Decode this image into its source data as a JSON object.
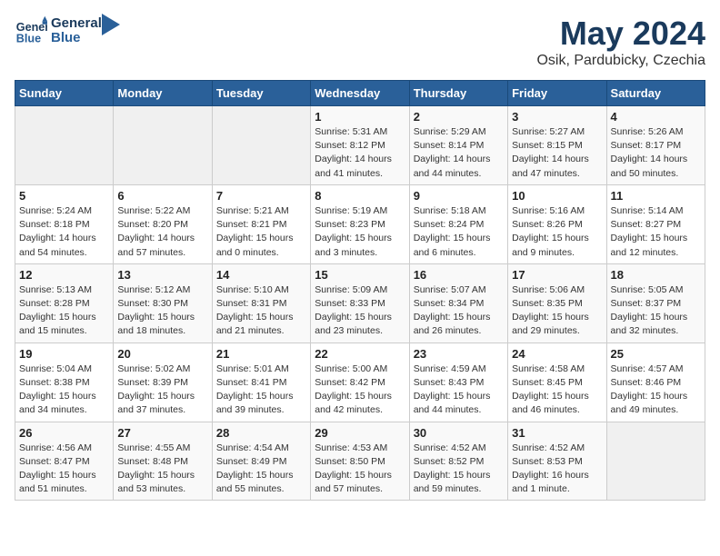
{
  "logo": {
    "line1": "General",
    "line2": "Blue"
  },
  "title": "May 2024",
  "subtitle": "Osik, Pardubicky, Czechia",
  "headers": [
    "Sunday",
    "Monday",
    "Tuesday",
    "Wednesday",
    "Thursday",
    "Friday",
    "Saturday"
  ],
  "weeks": [
    [
      {
        "day": "",
        "info": ""
      },
      {
        "day": "",
        "info": ""
      },
      {
        "day": "",
        "info": ""
      },
      {
        "day": "1",
        "info": "Sunrise: 5:31 AM\nSunset: 8:12 PM\nDaylight: 14 hours\nand 41 minutes."
      },
      {
        "day": "2",
        "info": "Sunrise: 5:29 AM\nSunset: 8:14 PM\nDaylight: 14 hours\nand 44 minutes."
      },
      {
        "day": "3",
        "info": "Sunrise: 5:27 AM\nSunset: 8:15 PM\nDaylight: 14 hours\nand 47 minutes."
      },
      {
        "day": "4",
        "info": "Sunrise: 5:26 AM\nSunset: 8:17 PM\nDaylight: 14 hours\nand 50 minutes."
      }
    ],
    [
      {
        "day": "5",
        "info": "Sunrise: 5:24 AM\nSunset: 8:18 PM\nDaylight: 14 hours\nand 54 minutes."
      },
      {
        "day": "6",
        "info": "Sunrise: 5:22 AM\nSunset: 8:20 PM\nDaylight: 14 hours\nand 57 minutes."
      },
      {
        "day": "7",
        "info": "Sunrise: 5:21 AM\nSunset: 8:21 PM\nDaylight: 15 hours\nand 0 minutes."
      },
      {
        "day": "8",
        "info": "Sunrise: 5:19 AM\nSunset: 8:23 PM\nDaylight: 15 hours\nand 3 minutes."
      },
      {
        "day": "9",
        "info": "Sunrise: 5:18 AM\nSunset: 8:24 PM\nDaylight: 15 hours\nand 6 minutes."
      },
      {
        "day": "10",
        "info": "Sunrise: 5:16 AM\nSunset: 8:26 PM\nDaylight: 15 hours\nand 9 minutes."
      },
      {
        "day": "11",
        "info": "Sunrise: 5:14 AM\nSunset: 8:27 PM\nDaylight: 15 hours\nand 12 minutes."
      }
    ],
    [
      {
        "day": "12",
        "info": "Sunrise: 5:13 AM\nSunset: 8:28 PM\nDaylight: 15 hours\nand 15 minutes."
      },
      {
        "day": "13",
        "info": "Sunrise: 5:12 AM\nSunset: 8:30 PM\nDaylight: 15 hours\nand 18 minutes."
      },
      {
        "day": "14",
        "info": "Sunrise: 5:10 AM\nSunset: 8:31 PM\nDaylight: 15 hours\nand 21 minutes."
      },
      {
        "day": "15",
        "info": "Sunrise: 5:09 AM\nSunset: 8:33 PM\nDaylight: 15 hours\nand 23 minutes."
      },
      {
        "day": "16",
        "info": "Sunrise: 5:07 AM\nSunset: 8:34 PM\nDaylight: 15 hours\nand 26 minutes."
      },
      {
        "day": "17",
        "info": "Sunrise: 5:06 AM\nSunset: 8:35 PM\nDaylight: 15 hours\nand 29 minutes."
      },
      {
        "day": "18",
        "info": "Sunrise: 5:05 AM\nSunset: 8:37 PM\nDaylight: 15 hours\nand 32 minutes."
      }
    ],
    [
      {
        "day": "19",
        "info": "Sunrise: 5:04 AM\nSunset: 8:38 PM\nDaylight: 15 hours\nand 34 minutes."
      },
      {
        "day": "20",
        "info": "Sunrise: 5:02 AM\nSunset: 8:39 PM\nDaylight: 15 hours\nand 37 minutes."
      },
      {
        "day": "21",
        "info": "Sunrise: 5:01 AM\nSunset: 8:41 PM\nDaylight: 15 hours\nand 39 minutes."
      },
      {
        "day": "22",
        "info": "Sunrise: 5:00 AM\nSunset: 8:42 PM\nDaylight: 15 hours\nand 42 minutes."
      },
      {
        "day": "23",
        "info": "Sunrise: 4:59 AM\nSunset: 8:43 PM\nDaylight: 15 hours\nand 44 minutes."
      },
      {
        "day": "24",
        "info": "Sunrise: 4:58 AM\nSunset: 8:45 PM\nDaylight: 15 hours\nand 46 minutes."
      },
      {
        "day": "25",
        "info": "Sunrise: 4:57 AM\nSunset: 8:46 PM\nDaylight: 15 hours\nand 49 minutes."
      }
    ],
    [
      {
        "day": "26",
        "info": "Sunrise: 4:56 AM\nSunset: 8:47 PM\nDaylight: 15 hours\nand 51 minutes."
      },
      {
        "day": "27",
        "info": "Sunrise: 4:55 AM\nSunset: 8:48 PM\nDaylight: 15 hours\nand 53 minutes."
      },
      {
        "day": "28",
        "info": "Sunrise: 4:54 AM\nSunset: 8:49 PM\nDaylight: 15 hours\nand 55 minutes."
      },
      {
        "day": "29",
        "info": "Sunrise: 4:53 AM\nSunset: 8:50 PM\nDaylight: 15 hours\nand 57 minutes."
      },
      {
        "day": "30",
        "info": "Sunrise: 4:52 AM\nSunset: 8:52 PM\nDaylight: 15 hours\nand 59 minutes."
      },
      {
        "day": "31",
        "info": "Sunrise: 4:52 AM\nSunset: 8:53 PM\nDaylight: 16 hours\nand 1 minute."
      },
      {
        "day": "",
        "info": ""
      }
    ]
  ]
}
